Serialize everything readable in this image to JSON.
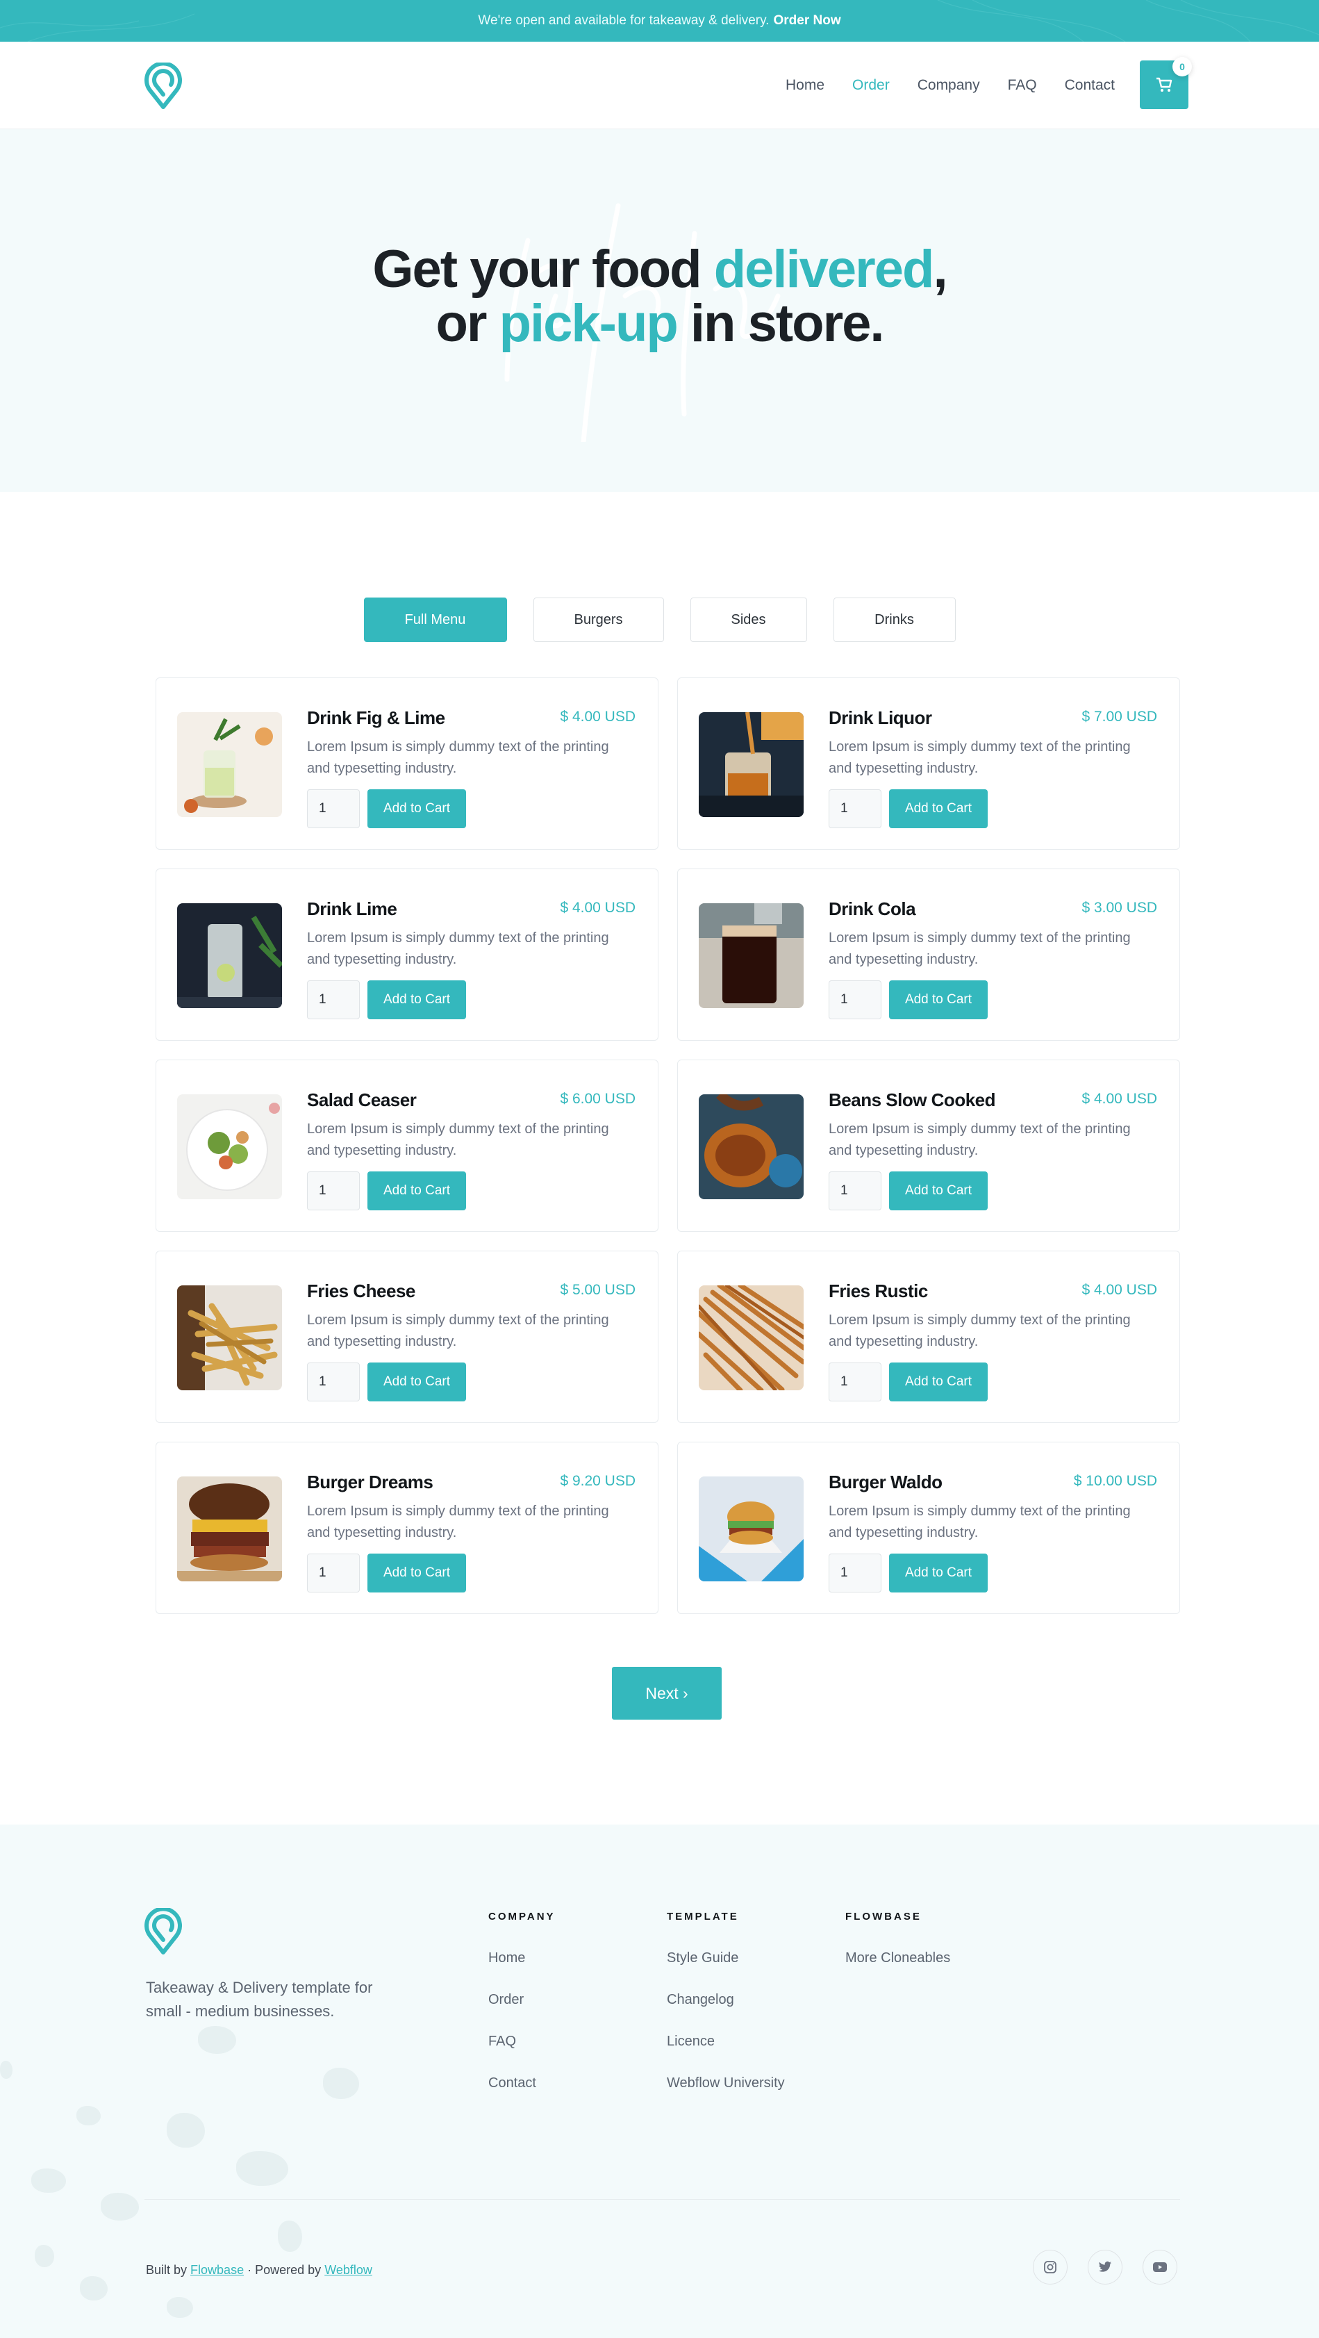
{
  "announcement": {
    "text": "We're open and available for takeaway & delivery.",
    "link": "Order Now"
  },
  "nav": {
    "items": [
      "Home",
      "Order",
      "Company",
      "FAQ",
      "Contact"
    ],
    "active": "Order",
    "cart_count": "0"
  },
  "hero": {
    "line1_pre": "Get your food ",
    "line1_accent": "delivered",
    "line1_post": ",",
    "line2_pre": "or ",
    "line2_accent": "pick-up",
    "line2_post": " in store."
  },
  "tabs": [
    "Full Menu",
    "Burgers",
    "Sides",
    "Drinks"
  ],
  "menu": {
    "desc": "Lorem Ipsum is simply dummy text of the printing and typesetting industry.",
    "qty": "1",
    "add_label": "Add to Cart",
    "items": [
      {
        "name": "Drink Fig & Lime",
        "price": "$ 4.00 USD"
      },
      {
        "name": "Drink Liquor",
        "price": "$ 7.00 USD"
      },
      {
        "name": "Drink Lime",
        "price": "$ 4.00 USD"
      },
      {
        "name": "Drink Cola",
        "price": "$ 3.00 USD"
      },
      {
        "name": "Salad Ceaser",
        "price": "$ 6.00 USD"
      },
      {
        "name": "Beans Slow Cooked",
        "price": "$ 4.00 USD"
      },
      {
        "name": "Fries Cheese",
        "price": "$ 5.00 USD"
      },
      {
        "name": "Fries Rustic",
        "price": "$ 4.00 USD"
      },
      {
        "name": "Burger Dreams",
        "price": "$ 9.20 USD"
      },
      {
        "name": "Burger Waldo",
        "price": "$ 10.00 USD"
      }
    ]
  },
  "pagination": {
    "next": "Next ›"
  },
  "footer": {
    "tagline": "Takeaway & Delivery template for small - medium businesses.",
    "columns": [
      {
        "title": "COMPANY",
        "links": [
          "Home",
          "Order",
          "FAQ",
          "Contact"
        ]
      },
      {
        "title": "TEMPLATE",
        "links": [
          "Style Guide",
          "Changelog",
          "Licence",
          "Webflow University"
        ]
      },
      {
        "title": "FLOWBASE",
        "links": [
          "More Cloneables"
        ]
      }
    ],
    "built_by": "Built by",
    "built_by_link": "Flowbase",
    "powered_by": "· Powered by",
    "powered_by_link": "Webflow",
    "social": [
      "instagram-icon",
      "twitter-icon",
      "youtube-icon"
    ]
  },
  "colors": {
    "accent": "#34b8bd",
    "hero_bg": "#f3fafb",
    "text": "#1c2126"
  }
}
